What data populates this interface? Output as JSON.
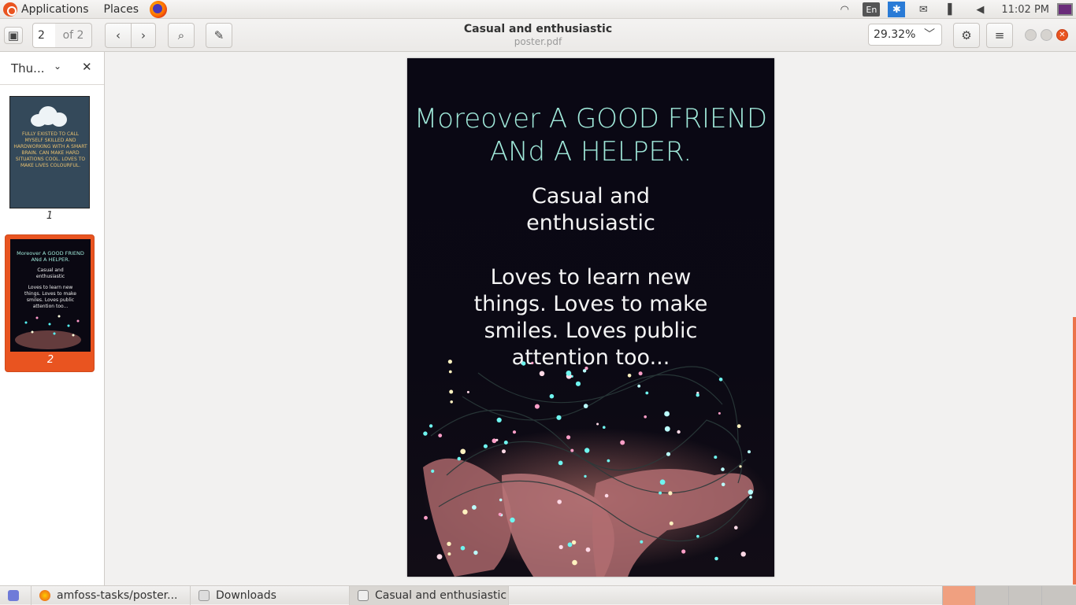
{
  "topbar": {
    "applications": "Applications",
    "places": "Places",
    "lang": "En",
    "clock": "11:02 PM"
  },
  "toolbar": {
    "page_current": "2",
    "page_of": "of 2",
    "zoom": "29.32%"
  },
  "window": {
    "title": "Casual and enthusiastic",
    "subtitle": "poster.pdf"
  },
  "sidebar": {
    "label": "Thu...",
    "thumbs": [
      {
        "num": "1",
        "text": "FULLY EXISTED TO CALL MYSELF SKILLED AND HARDWORKING WITH A SMART BRAIN. CAN MAKE HARD SITUATIONS COOL. LOVES TO MAKE LIVES COLOURFUL."
      },
      {
        "num": "2",
        "heading": "Moreover A GOOD FRIEND ANd A HELPER.",
        "line1": "Casual and enthusiastic",
        "line2": "Loves to learn new things. Loves to make smiles. Loves public attention too..."
      }
    ]
  },
  "poster": {
    "heading_l1": "Moreover A GOOD FRIEND",
    "heading_l2": "ANd A HELPER.",
    "sub_l1": "Casual and",
    "sub_l2": "enthusiastic",
    "body_l1": "Loves to learn new",
    "body_l2": "things. Loves to make",
    "body_l3": "smiles. Loves public",
    "body_l4": "attention too..."
  },
  "taskbar": {
    "items": [
      "amfoss-tasks/poster...",
      "Downloads",
      "Casual and enthusiastic"
    ]
  },
  "colors": {
    "accent": "#e95420",
    "poster_heading": "#9fe8d9",
    "poster_bg": "#0a0814"
  }
}
